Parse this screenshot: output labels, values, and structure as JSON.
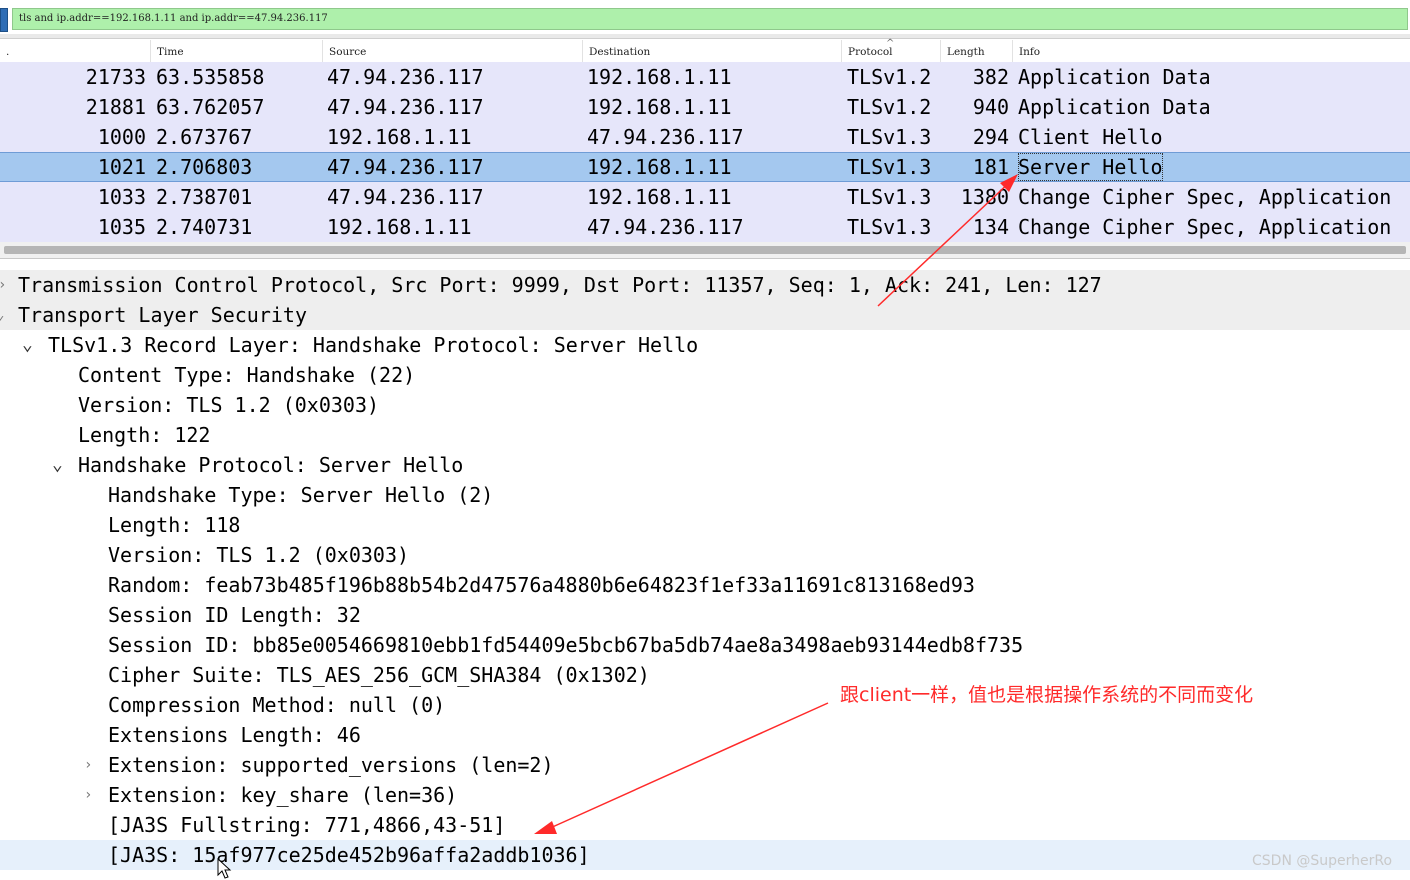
{
  "filter": {
    "value": "tls and ip.addr==192.168.1.11 and ip.addr==47.94.236.117"
  },
  "packet_list": {
    "columns": [
      "Time",
      "Source",
      "Destination",
      "Protocol",
      "Length",
      "Info"
    ],
    "rows": [
      {
        "no": "21733",
        "time": "63.535858",
        "source": "47.94.236.117",
        "destination": "192.168.1.11",
        "protocol": "TLSv1.2",
        "length": "382",
        "info": "Application Data"
      },
      {
        "no": "21881",
        "time": "63.762057",
        "source": "47.94.236.117",
        "destination": "192.168.1.11",
        "protocol": "TLSv1.2",
        "length": "940",
        "info": "Application Data"
      },
      {
        "no": "1000",
        "time": "2.673767",
        "source": "192.168.1.11",
        "destination": "47.94.236.117",
        "protocol": "TLSv1.3",
        "length": "294",
        "info": "Client Hello"
      },
      {
        "no": "1021",
        "time": "2.706803",
        "source": "47.94.236.117",
        "destination": "192.168.1.11",
        "protocol": "TLSv1.3",
        "length": "181",
        "info": "Server Hello"
      },
      {
        "no": "1033",
        "time": "2.738701",
        "source": "47.94.236.117",
        "destination": "192.168.1.11",
        "protocol": "TLSv1.3",
        "length": "1380",
        "info": "Change Cipher Spec, Application"
      },
      {
        "no": "1035",
        "time": "2.740731",
        "source": "192.168.1.11",
        "destination": "47.94.236.117",
        "protocol": "TLSv1.3",
        "length": "134",
        "info": "Change Cipher Spec, Application"
      }
    ]
  },
  "details": [
    "Transmission Control Protocol, Src Port: 9999, Dst Port: 11357, Seq: 1, Ack: 241, Len: 127",
    "Transport Layer Security",
    "TLSv1.3 Record Layer: Handshake Protocol: Server Hello",
    "Content Type: Handshake (22)",
    "Version: TLS 1.2 (0x0303)",
    "Length: 122",
    "Handshake Protocol: Server Hello",
    "Handshake Type: Server Hello (2)",
    "Length: 118",
    "Version: TLS 1.2 (0x0303)",
    "Random: feab73b485f196b88b54b2d47576a4880b6e64823f1ef33a11691c813168ed93",
    "Session ID Length: 32",
    "Session ID: bb85e0054669810ebb1fd54409e5bcb67ba5db74ae8a3498aeb93144edb8f735",
    "Cipher Suite: TLS_AES_256_GCM_SHA384 (0x1302)",
    "Compression Method: null (0)",
    "Extensions Length: 46",
    "Extension: supported_versions (len=2)",
    "Extension: key_share (len=36)",
    "[JA3S Fullstring: 771,4866,43-51]",
    "[JA3S: 15af977ce25de452b96affa2addb1036]"
  ],
  "annotation": "跟client一样，值也是根据操作系统的不同而变化",
  "watermark": "CSDN @SuperherRo",
  "colors": {
    "filter_bg": "#aef0ab",
    "row_bg": "#e6e6fa",
    "selected_row": "#a4c8ef",
    "annotation": "#ff2a2a"
  }
}
